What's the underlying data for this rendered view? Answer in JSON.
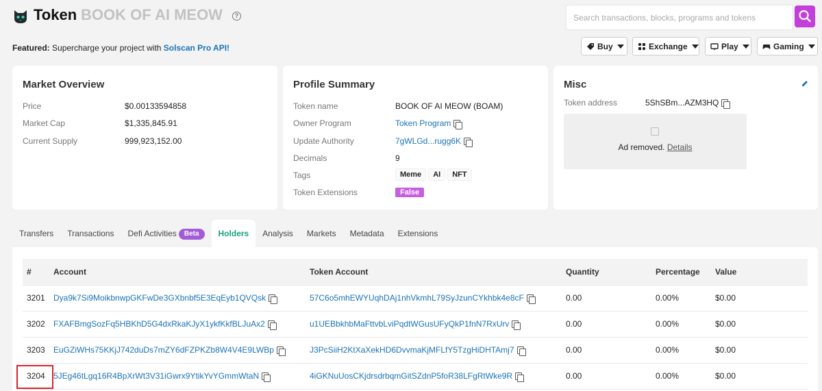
{
  "header": {
    "title": "Token",
    "token_name": "BOOK OF AI MEOW",
    "search_placeholder": "Search transactions, blocks, programs and tokens",
    "icons": [
      "logo-icon",
      "help-icon",
      "search-icon"
    ]
  },
  "featured": {
    "label": "Featured:",
    "text": "Supercharge your project with",
    "link": "Solscan Pro API!"
  },
  "nav": {
    "buy": "Buy",
    "exchange": "Exchange",
    "play": "Play",
    "gaming": "Gaming"
  },
  "market": {
    "title": "Market Overview",
    "price_label": "Price",
    "price": "$0.00133594858",
    "cap_label": "Market Cap",
    "cap": "$1,335,845.91",
    "supply_label": "Current Supply",
    "supply": "999,923,152.00"
  },
  "profile": {
    "title": "Profile Summary",
    "name_label": "Token name",
    "name": "BOOK OF AI MEOW (BOAM)",
    "owner_label": "Owner Program",
    "owner": "Token Program",
    "authority_label": "Update Authority",
    "authority": "7gWLGd...rugg6K",
    "decimals_label": "Decimals",
    "decimals": "9",
    "tags_label": "Tags",
    "tags": [
      "Meme",
      "AI",
      "NFT"
    ],
    "ext_label": "Token Extensions",
    "ext": "False"
  },
  "misc": {
    "title": "Misc",
    "address_label": "Token address",
    "address": "5ShSBm...AZM3HQ",
    "ad_text": "Ad removed.",
    "ad_link": "Details"
  },
  "tabs": [
    {
      "label": "Transfers"
    },
    {
      "label": "Transactions"
    },
    {
      "label": "Defi Activities",
      "badge": "Beta"
    },
    {
      "label": "Holders",
      "active": true
    },
    {
      "label": "Analysis"
    },
    {
      "label": "Markets"
    },
    {
      "label": "Metadata"
    },
    {
      "label": "Extensions"
    }
  ],
  "table": {
    "headers": {
      "rank": "#",
      "account": "Account",
      "token_account": "Token Account",
      "quantity": "Quantity",
      "percentage": "Percentage",
      "value": "Value"
    },
    "rows": [
      {
        "rank": "3201",
        "account": "Dya9k7Si9MoikbnwpGKFwDe3GXbnbf5E3EqEyb1QVQsk",
        "token_account": "57C6o5mhEWYUqhDAj1nhVkmhL79SyJzunCYkhbk4e8cF",
        "quantity": "0.00",
        "percentage": "0.00%",
        "value": "$0.00"
      },
      {
        "rank": "3202",
        "account": "FXAFBmgSozFq5HBKhD5G4dxRkaKJyX1ykfKkfBLJuAx2",
        "token_account": "u1UEBbkhbMaFttvbLviPqdtWGusUFyQkP1fnN7RxUrv",
        "quantity": "0.00",
        "percentage": "0.00%",
        "value": "$0.00"
      },
      {
        "rank": "3203",
        "account": "EuGZiWHs75KKjJ742duDs7mZY6dFZPKZb8W4V4E9LWBp",
        "token_account": "J3PcSiiH2KtXaXekHD6DvvmaKjMFLfY5TzgHiDHTAmj7",
        "quantity": "0.00",
        "percentage": "0.00%",
        "value": "$0.00"
      },
      {
        "rank": "3204",
        "account": "5JEg46tLgq16R4BpXrWt3V31iGwrx9YtikYvYGmmWtaN",
        "token_account": "4iGKNuUosCKjdrsdrbqmGitSZdnP5foR38LFgRtWke9R",
        "quantity": "0.00",
        "percentage": "0.00%",
        "value": "$0.00"
      }
    ]
  },
  "colors": {
    "accent": "#c23fd9",
    "link": "#1a73b8",
    "active_tab": "#14a37f",
    "highlight": "#d9232a"
  }
}
